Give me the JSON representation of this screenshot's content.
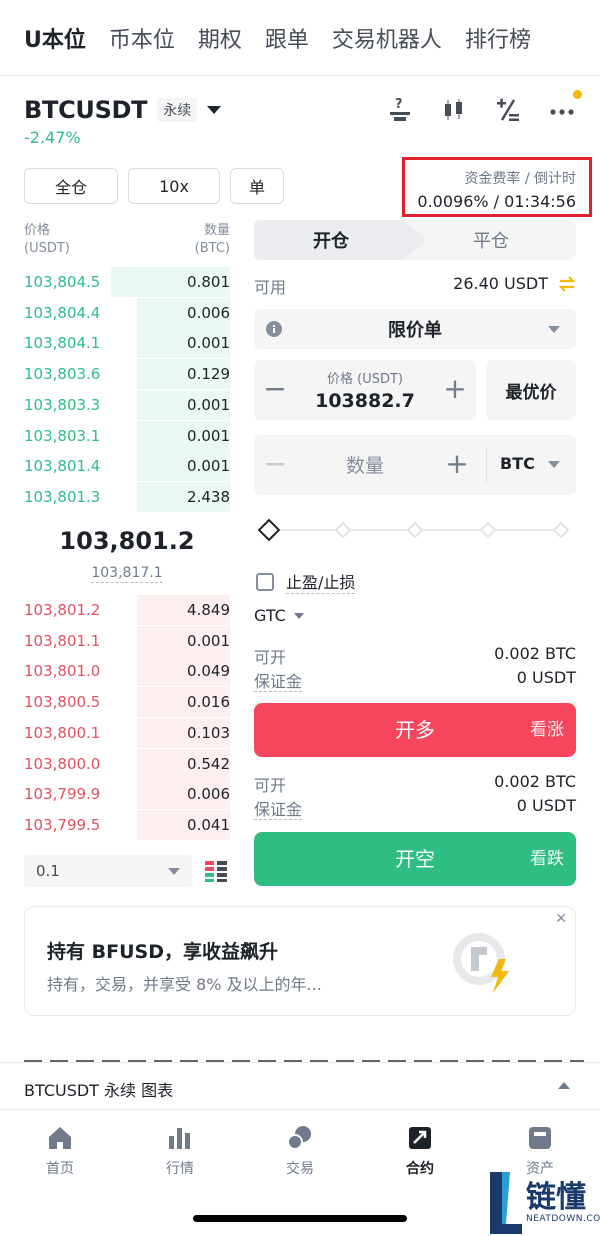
{
  "top_tabs": [
    "U本位",
    "币本位",
    "期权",
    "跟单",
    "交易机器人",
    "排行榜"
  ],
  "symbol": {
    "name": "BTCUSDT",
    "badge": "永续",
    "change": "-2.47%"
  },
  "settings": {
    "margin_mode": "全仓",
    "leverage": "10x",
    "position_mode": "单"
  },
  "funding": {
    "label": "资金费率 / 倒计时",
    "value": "0.0096% / 01:34:56"
  },
  "order_book": {
    "price_header": "价格",
    "price_unit": "(USDT)",
    "qty_header": "数量",
    "qty_unit": "(BTC)",
    "asks": [
      {
        "price": "103,804.5",
        "qty": "0.801",
        "depth": 0.58
      },
      {
        "price": "103,804.4",
        "qty": "0.006",
        "depth": 0.45
      },
      {
        "price": "103,804.1",
        "qty": "0.001",
        "depth": 0.45
      },
      {
        "price": "103,803.6",
        "qty": "0.129",
        "depth": 0.45
      },
      {
        "price": "103,803.3",
        "qty": "0.001",
        "depth": 0.45
      },
      {
        "price": "103,803.1",
        "qty": "0.001",
        "depth": 0.45
      },
      {
        "price": "103,801.4",
        "qty": "0.001",
        "depth": 0.45
      },
      {
        "price": "103,801.3",
        "qty": "2.438",
        "depth": 0.45
      }
    ],
    "mid_price": "103,801.2",
    "mark_price": "103,817.1",
    "bids": [
      {
        "price": "103,801.2",
        "qty": "4.849",
        "depth": 0.45
      },
      {
        "price": "103,801.1",
        "qty": "0.001",
        "depth": 0.45
      },
      {
        "price": "103,801.0",
        "qty": "0.049",
        "depth": 0.45
      },
      {
        "price": "103,800.5",
        "qty": "0.016",
        "depth": 0.45
      },
      {
        "price": "103,800.1",
        "qty": "0.103",
        "depth": 0.45
      },
      {
        "price": "103,800.0",
        "qty": "0.542",
        "depth": 0.45
      },
      {
        "price": "103,799.9",
        "qty": "0.006",
        "depth": 0.45
      },
      {
        "price": "103,799.5",
        "qty": "0.041",
        "depth": 0.45
      }
    ],
    "depth_step": "0.1"
  },
  "form": {
    "open_tab": "开仓",
    "close_tab": "平仓",
    "available_label": "可用",
    "available_value": "26.40 USDT",
    "order_type": "限价单",
    "price_label": "价格 (USDT)",
    "price_value": "103882.7",
    "best_price": "最优价",
    "qty_placeholder": "数量",
    "qty_unit": "BTC",
    "tpsl_label": "止盈/止损",
    "tif": "GTC",
    "buy_info": {
      "can_open_label": "可开",
      "can_open_value": "0.002 BTC",
      "margin_label": "保证金",
      "margin_value": "0 USDT"
    },
    "sell_info": {
      "can_open_label": "可开",
      "can_open_value": "0.002 BTC",
      "margin_label": "保证金",
      "margin_value": "0 USDT"
    },
    "buy_label": "开多",
    "buy_sub": "看涨",
    "sell_label": "开空",
    "sell_sub": "看跌"
  },
  "promo": {
    "title": "持有 BFUSD，享收益飙升",
    "subtitle": "持有，交易，并享受 8% 及以上的年..."
  },
  "chart_bar": {
    "label": "BTCUSDT 永续  图表"
  },
  "bottom_nav": [
    "首页",
    "行情",
    "交易",
    "合约",
    "资产"
  ],
  "watermark": {
    "text": "链懂",
    "sub": "NEATDOWN.COM"
  },
  "colors": {
    "buy": "#f6465d",
    "sell": "#2ebd85",
    "accent": "#f0b90b",
    "highlight_box": "#e0202a"
  }
}
